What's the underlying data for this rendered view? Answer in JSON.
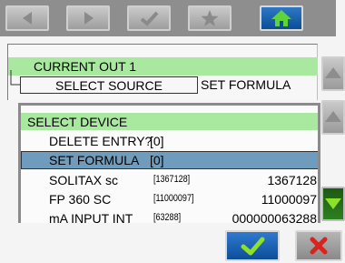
{
  "toolbar": {
    "icons": [
      "back-arrow-icon",
      "forward-arrow-icon",
      "check-icon",
      "star-icon",
      "home-icon"
    ]
  },
  "menu": {
    "current_out": "CURRENT OUT 1",
    "select_source": "SELECT SOURCE",
    "select_source_value": "SET FORMULA"
  },
  "device_list": {
    "title": "SELECT DEVICE",
    "items": [
      {
        "label": "DELETE ENTRY?",
        "bracket": "[0]",
        "value": ""
      },
      {
        "label": "SET FORMULA",
        "bracket": "[0]",
        "value": ""
      },
      {
        "label": "SOLITAX sc",
        "bracket": "[1367128]",
        "value": "1367128"
      },
      {
        "label": "FP 360 SC",
        "bracket": "[11000097]",
        "value": "11000097"
      },
      {
        "label": "mA INPUT INT",
        "bracket": "[63288]",
        "value": "000000063288"
      }
    ],
    "selected_index": 1
  },
  "colors": {
    "highlight_green": "#a9e89f",
    "selection_blue": "#6f9cbc",
    "home_blue": "#0b4d96",
    "down_green": "#2f7f22",
    "cancel_red": "#d9231f",
    "confirm_green": "#8fe028"
  },
  "side_buttons": {
    "icons": [
      "scroll-up-icon",
      "scroll-up-icon",
      "scroll-down-icon"
    ]
  },
  "actions": {
    "icons": [
      "confirm-check-icon",
      "cancel-x-icon"
    ]
  }
}
